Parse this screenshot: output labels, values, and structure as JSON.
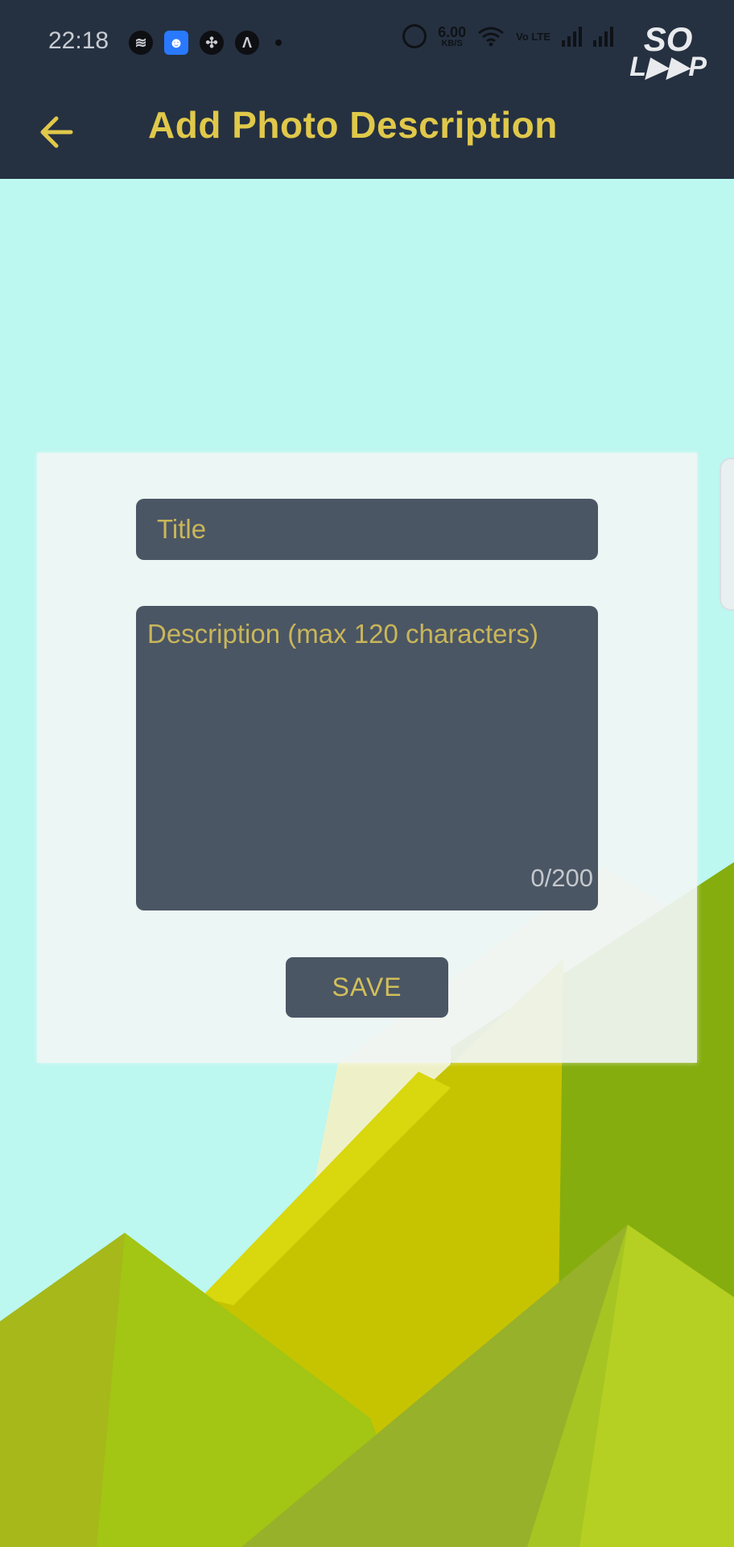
{
  "status_bar": {
    "time": "22:18",
    "app_icons": [
      "spotify-icon",
      "android-icon",
      "app-grid-icon",
      "arrow-icon"
    ],
    "net_speed_value": "6.00",
    "net_speed_unit": "KB/S",
    "volte": "Vo LTE",
    "watermark_top": "SO",
    "watermark_bottom": "L▶▶P"
  },
  "app_bar": {
    "title": "Add Photo Description",
    "back_icon": "arrow-left-icon"
  },
  "form": {
    "title_placeholder": "Title",
    "title_value": "",
    "description_placeholder": "Description (max 120 characters)",
    "description_value": "",
    "counter": "0/200",
    "save_label": "SAVE"
  },
  "colors": {
    "app_bar": "#253141",
    "accent": "#e0c84a",
    "sky": "#bcf7f0",
    "input_bg": "#4b5664"
  }
}
